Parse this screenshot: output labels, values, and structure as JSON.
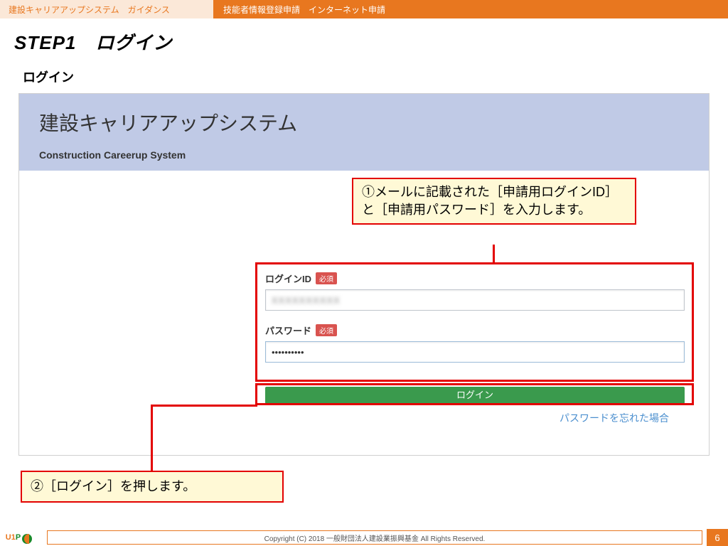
{
  "header": {
    "left": "建設キャリアアップシステム　ガイダンス",
    "right": "技能者情報登録申請　インターネット申請"
  },
  "step": {
    "title": "STEP1　ログイン"
  },
  "section": {
    "title": "ログイン"
  },
  "banner": {
    "jp": "建設キャリアアップシステム",
    "en": "Construction Careerup System"
  },
  "callouts": {
    "c1": "①メールに記載された［申請用ログインID］と［申請用パスワード］を入力します。",
    "c2": "②［ログイン］を押します。"
  },
  "form": {
    "id_label": "ログインID",
    "pw_label": "パスワード",
    "required_badge": "必須",
    "id_value": "XXXXXXXXXX",
    "pw_value": "••••••••••",
    "login_button": "ログイン",
    "forgot": "パスワードを忘れた場合"
  },
  "footer": {
    "copyright": "Copyright (C) 2018 一般財団法人建設業振興基金 All Rights Reserved.",
    "page": "6",
    "logo_u1": "U1",
    "logo_p": "P"
  }
}
